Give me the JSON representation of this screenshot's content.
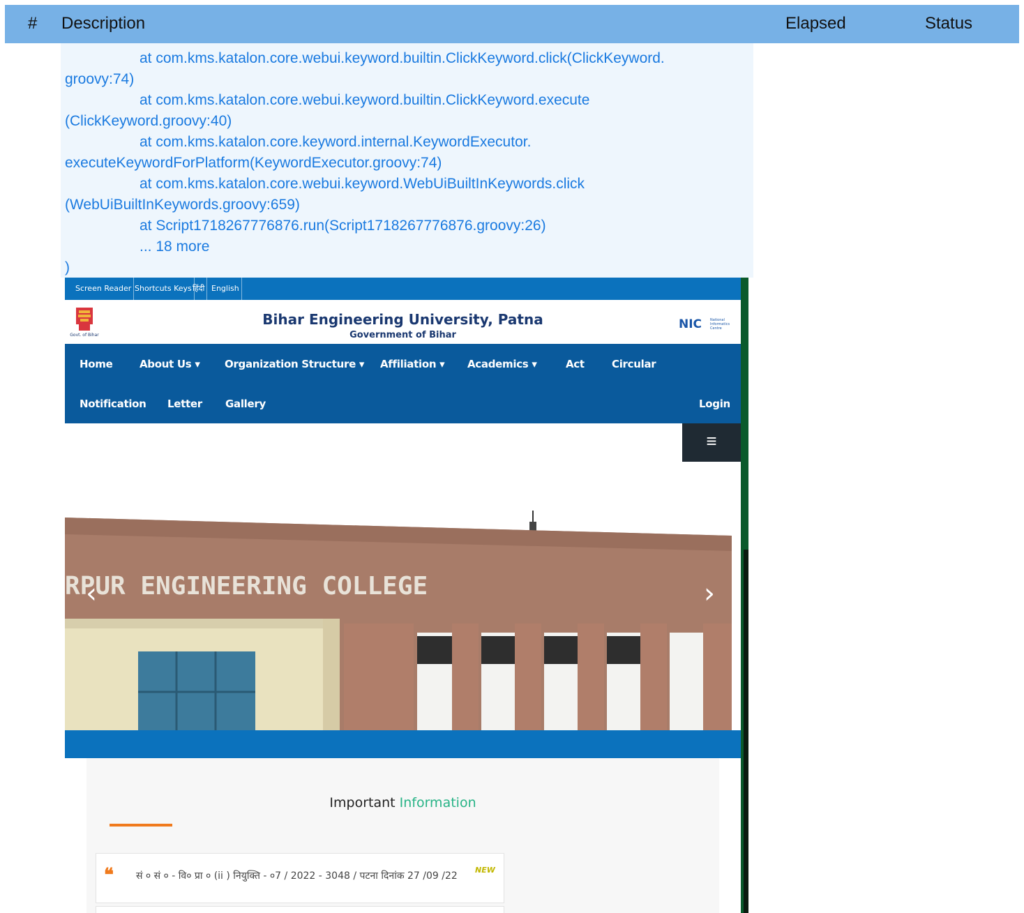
{
  "report_header": {
    "num": "#",
    "description": "Description",
    "elapsed": "Elapsed",
    "status": "Status"
  },
  "trace": {
    "lines": [
      {
        "text": "at com.kms.katalon.core.webui.keyword.builtin.ClickKeyword.click(ClickKeyword.",
        "indent": true
      },
      {
        "text": "groovy:74)",
        "indent": false
      },
      {
        "text": "at com.kms.katalon.core.webui.keyword.builtin.ClickKeyword.execute",
        "indent": true
      },
      {
        "text": "(ClickKeyword.groovy:40)",
        "indent": false
      },
      {
        "text": "at com.kms.katalon.core.keyword.internal.KeywordExecutor.",
        "indent": true
      },
      {
        "text": "executeKeywordForPlatform(KeywordExecutor.groovy:74)",
        "indent": false
      },
      {
        "text": "at com.kms.katalon.core.webui.keyword.WebUiBuiltInKeywords.click",
        "indent": true
      },
      {
        "text": "(WebUiBuiltInKeywords.groovy:659)",
        "indent": false
      },
      {
        "text": "at Script1718267776876.run(Script1718267776876.groovy:26)",
        "indent": true
      },
      {
        "text": "... 18 more",
        "indent": true
      },
      {
        "text": ")",
        "indent": false
      }
    ]
  },
  "site": {
    "topbar": [
      "Screen Reader",
      "Shortcuts Keys",
      "हिंदी",
      "English"
    ],
    "title": "Bihar Engineering University, Patna",
    "subtitle": "Government of Bihar",
    "emblem_caption": "Govt. of Bihar",
    "nic_label": "NIC",
    "nic_sub": [
      "National",
      "Informatics",
      "Centre"
    ],
    "nav": {
      "home": "Home",
      "about": "About Us ▾",
      "org": "Organization Structure ▾",
      "affiliation": "Affiliation ▾",
      "academics": "Academics ▾",
      "act": "Act",
      "circular": "Circular",
      "notification": "Notification",
      "letter": "Letter",
      "gallery": "Gallery",
      "login": "Login"
    },
    "hamburger": "≡",
    "hero_text": "RPUR    ENGINEERING    COLLEGE",
    "arrow_prev": "‹",
    "arrow_next": "›",
    "info": {
      "title_a": "Important ",
      "title_b": "Information",
      "item_text": "सं ० सं ० - वि० प्रा ० (ii ) नियुक्ति - ०7 / 2022 - 3048 / पटना दिनांक 27 /09 /22",
      "new_badge": "NEW"
    }
  }
}
